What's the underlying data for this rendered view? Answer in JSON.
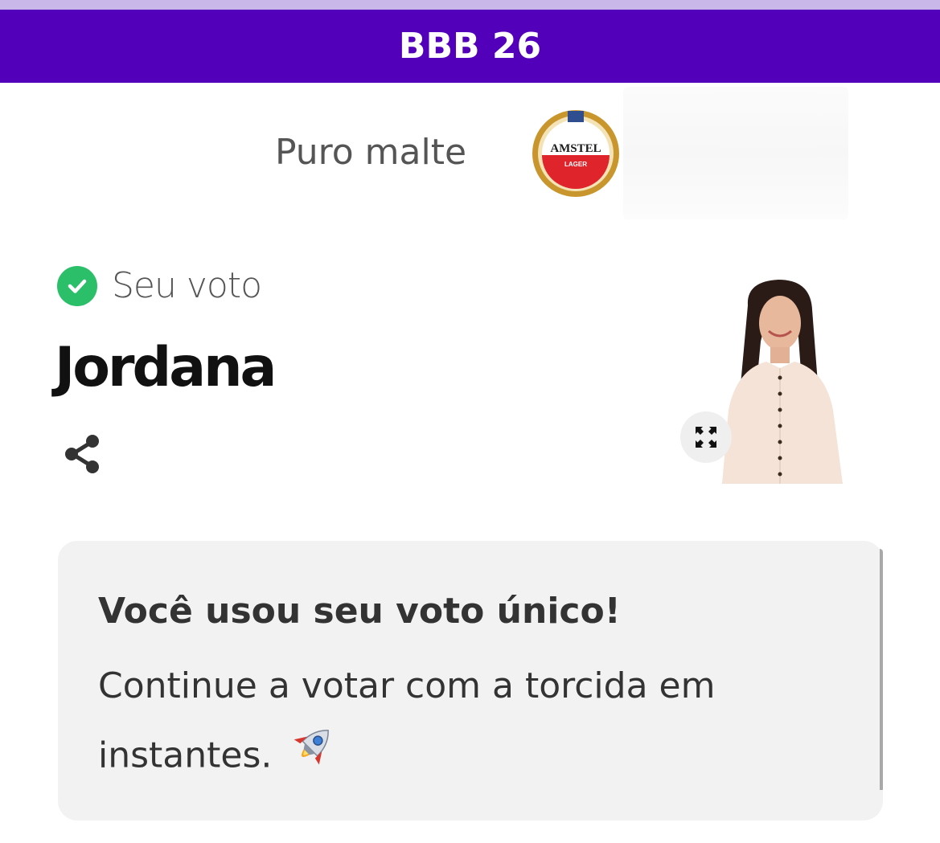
{
  "header": {
    "title": "BBB 26",
    "bg_color": "#5200b9"
  },
  "sponsor": {
    "tagline": "Puro malte",
    "logo_text_top": "AMSTEL",
    "logo_text_bottom": "LAGER"
  },
  "vote": {
    "label": "Seu voto",
    "candidate_name": "Jordana",
    "check_color": "#2bbf6a"
  },
  "icons": {
    "check": "check-circle-icon",
    "share": "share-icon",
    "expand": "expand-icon",
    "rocket": "rocket-emoji"
  },
  "notice": {
    "title": "Você usou seu voto único!",
    "body": "Continue a votar com a torcida em instantes."
  }
}
